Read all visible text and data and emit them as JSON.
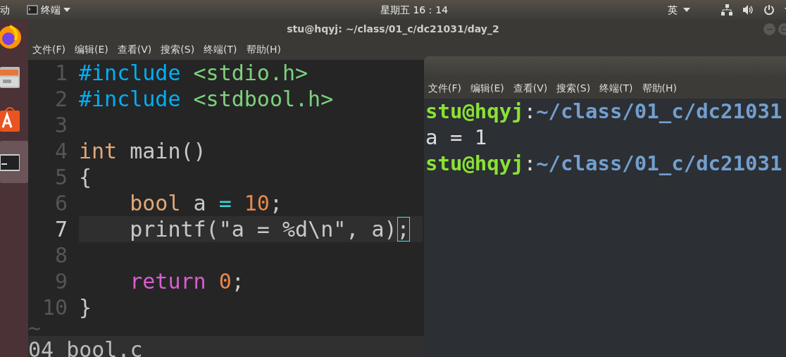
{
  "top_bar": {
    "activities": "动",
    "app_menu": "终端",
    "clock": "星期五 16：14",
    "input_method": "英"
  },
  "dock": [
    {
      "kind": "browser",
      "active": false
    },
    {
      "kind": "files",
      "active": false
    },
    {
      "kind": "store",
      "active": false
    },
    {
      "kind": "terminal",
      "active": true
    }
  ],
  "editor_window": {
    "title": "stu@hqyj: ~/class/01_c/dc21031/day_2",
    "menu": [
      "文件(F)",
      "编辑(E)",
      "查看(V)",
      "搜索(S)",
      "终端(T)",
      "帮助(H)"
    ],
    "lines": [
      {
        "number": "1",
        "current": false,
        "tokens": [
          {
            "text": "#include",
            "kind": "preproc"
          },
          {
            "text": " <stdio.h>",
            "kind": "string"
          }
        ]
      },
      {
        "number": "2",
        "current": false,
        "tokens": [
          {
            "text": "#include",
            "kind": "preproc"
          },
          {
            "text": " <stdbool.h>",
            "kind": "string"
          }
        ]
      },
      {
        "number": "3",
        "current": false
      },
      {
        "number": "4",
        "current": false,
        "tokens": [
          {
            "text": "int",
            "kind": "type"
          },
          {
            "text": " main()",
            "kind": "plain"
          }
        ]
      },
      {
        "number": "5",
        "current": false,
        "tokens": [
          {
            "text": "{",
            "kind": "plain"
          }
        ]
      },
      {
        "number": "6",
        "current": false,
        "tokens": [
          {
            "text": "    bool",
            "kind": "type"
          },
          {
            "text": " a ",
            "kind": "plain"
          },
          {
            "text": "=",
            "kind": "operator"
          },
          {
            "text": " 10",
            "kind": "number"
          },
          {
            "text": ";",
            "kind": "plain"
          }
        ]
      },
      {
        "number": "7",
        "current": true,
        "tokens": [
          {
            "text": "    printf(",
            "kind": "plain"
          },
          {
            "text": "\"a = %d\\n\"",
            "kind": "plain"
          },
          {
            "text": ", a)",
            "kind": "plain"
          },
          {
            "text": ";",
            "kind": "cursor"
          }
        ]
      },
      {
        "number": "8",
        "current": false
      },
      {
        "number": "9",
        "current": false,
        "tokens": [
          {
            "text": "    return",
            "kind": "keyword"
          },
          {
            "text": " 0",
            "kind": "number"
          },
          {
            "text": ";",
            "kind": "plain"
          }
        ]
      },
      {
        "number": "10",
        "current": false,
        "tokens": [
          {
            "text": "}",
            "kind": "plain"
          }
        ]
      }
    ],
    "filler": "~",
    "status_line": "04 bool.c"
  },
  "terminal_window": {
    "menu": [
      "文件(F)",
      "编辑(E)",
      "查看(V)",
      "搜索(S)",
      "终端(T)",
      "帮助(H)"
    ],
    "lines": [
      [
        {
          "text": "stu@hqyj",
          "kind": "user"
        },
        {
          "text": ":",
          "kind": "plain"
        },
        {
          "text": "~/class/01_c/dc21031",
          "kind": "path"
        }
      ],
      [
        {
          "text": "a = 1",
          "kind": "plain"
        }
      ],
      [
        {
          "text": "stu@hqyj",
          "kind": "user"
        },
        {
          "text": ":",
          "kind": "plain"
        },
        {
          "text": "~/class/01_c/dc21031",
          "kind": "path"
        }
      ]
    ]
  }
}
